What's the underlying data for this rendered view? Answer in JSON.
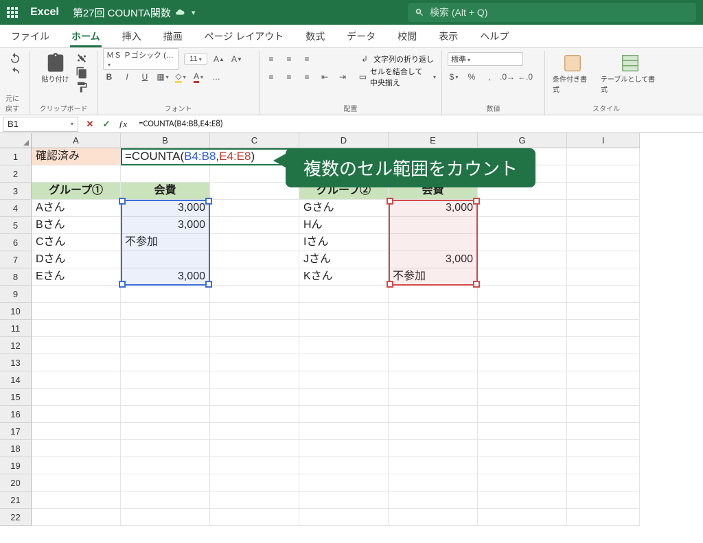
{
  "title": {
    "app": "Excel",
    "doc": "第27回 COUNTA関数"
  },
  "search": {
    "placeholder": "検索 (Alt + Q)"
  },
  "tabs": [
    "ファイル",
    "ホーム",
    "挿入",
    "描画",
    "ページ レイアウト",
    "数式",
    "データ",
    "校閲",
    "表示",
    "ヘルプ"
  ],
  "active_tab_index": 1,
  "ribbon": {
    "undo_group": "元に戻す",
    "clipboard": {
      "paste": "貼り付け",
      "group": "クリップボード"
    },
    "font": {
      "name": "ＭＳ Ｐゴシック (…",
      "size": "11",
      "group": "フォント",
      "bold": "B",
      "italic": "I",
      "underline": "U"
    },
    "align": {
      "wrap": "文字列の折り返し",
      "merge": "セルを結合して中央揃え",
      "group": "配置"
    },
    "number": {
      "fmt": "標準",
      "group": "数値"
    },
    "styles": {
      "condfmt": "条件付き書式",
      "tablefmt": "テーブルとして書式",
      "group": "スタイル"
    }
  },
  "formula_bar": {
    "ref": "B1",
    "formula": "=COUNTA(B4:B8,E4:E8)"
  },
  "col_headers": [
    "A",
    "B",
    "C",
    "D",
    "E",
    "G",
    "I"
  ],
  "row_headers": [
    "1",
    "2",
    "3",
    "4",
    "5",
    "6",
    "7",
    "8",
    "9",
    "10",
    "11",
    "12",
    "13",
    "14",
    "15",
    "16",
    "17",
    "18",
    "19",
    "20",
    "21",
    "22"
  ],
  "cells": {
    "A1": "確認済み",
    "B1_formula": {
      "pre": "=COUNTA(",
      "r1": "B4:B8",
      "comma": ",",
      "r2": "E4:E8",
      "post": ")"
    },
    "A3": "グループ①",
    "B3": "会費",
    "D3": "グループ②",
    "E3": "会費",
    "A4": "Aさん",
    "A5": "Bさん",
    "A6": "Cさん",
    "A7": "Dさん",
    "A8": "Eさん",
    "B4": "3,000",
    "B5": "3,000",
    "B6": "不参加",
    "B8": "3,000",
    "D4": "Gさん",
    "D5": "Hん",
    "D6": "Iさん",
    "D7": "Jさん",
    "D8": "Kさん",
    "E4": "3,000",
    "E7": "3,000",
    "E8": "不参加"
  },
  "callout": "複数のセル範囲をカウント"
}
